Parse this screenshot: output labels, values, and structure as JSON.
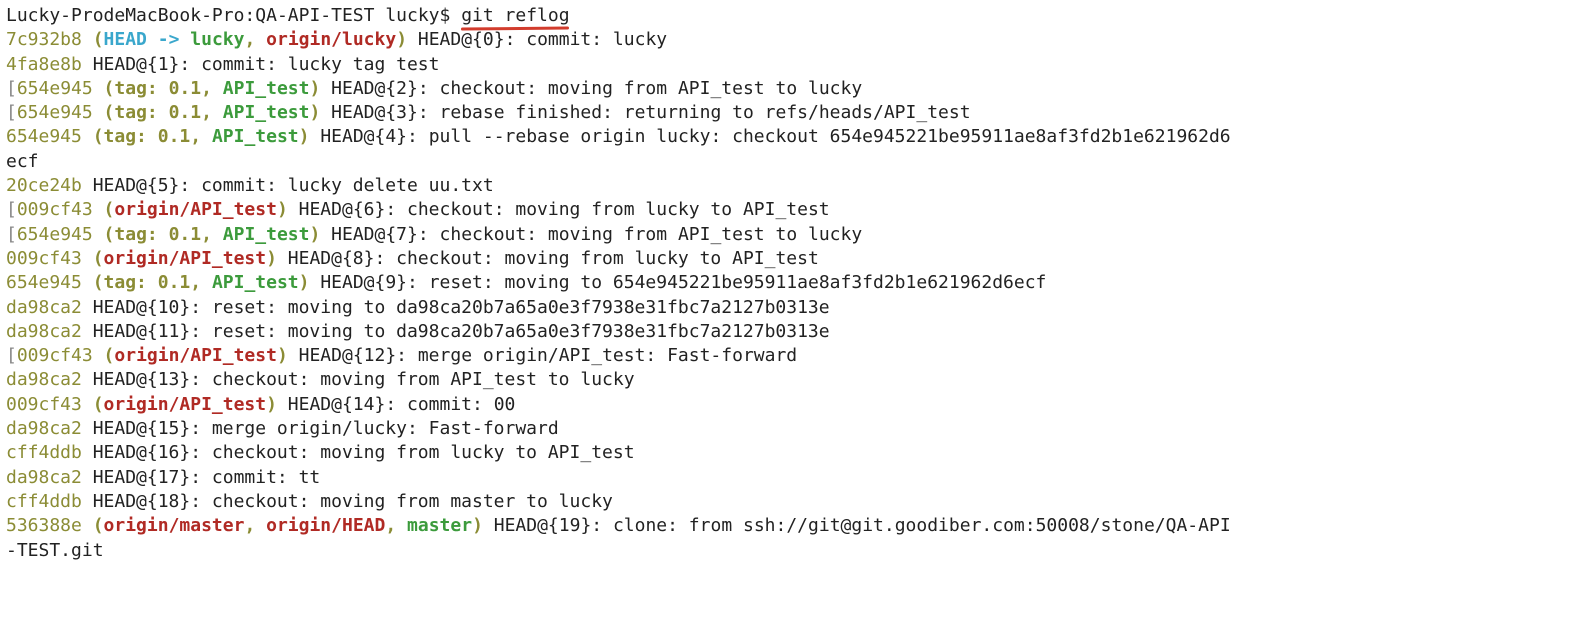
{
  "prompt": {
    "host": "Lucky-ProdeMacBook-Pro",
    "sep": ":",
    "dir": "QA-API-TEST",
    "user": "lucky",
    "dollar": "$",
    "command": "git reflog"
  },
  "wrap_continuation_1": "ecf",
  "wrap_continuation_2": "-TEST.git",
  "entries": [
    {
      "index": 0,
      "lb": "",
      "hash": "7c932b8",
      "refs": [
        {
          "kind": "head",
          "text": "HEAD"
        },
        {
          "kind": "arrow",
          "text": " -> "
        },
        {
          "kind": "branch",
          "text": "lucky"
        },
        {
          "kind": "plain",
          "text": ", "
        },
        {
          "kind": "remote",
          "text": "origin/lucky"
        }
      ],
      "msg": " HEAD@{0}: commit: lucky"
    },
    {
      "index": 1,
      "lb": "",
      "hash": "4fa8e8b",
      "refs": null,
      "msg": " HEAD@{1}: commit: lucky tag test"
    },
    {
      "index": 2,
      "lb": "[",
      "hash": "654e945",
      "refs": [
        {
          "kind": "tag",
          "text": "tag: 0.1"
        },
        {
          "kind": "plain",
          "text": ", "
        },
        {
          "kind": "branch",
          "text": "API_test"
        }
      ],
      "msg": " HEAD@{2}: checkout: moving from API_test to lucky"
    },
    {
      "index": 3,
      "lb": "[",
      "hash": "654e945",
      "refs": [
        {
          "kind": "tag",
          "text": "tag: 0.1"
        },
        {
          "kind": "plain",
          "text": ", "
        },
        {
          "kind": "branch",
          "text": "API_test"
        }
      ],
      "msg": " HEAD@{3}: rebase finished: returning to refs/heads/API_test"
    },
    {
      "index": 4,
      "lb": "",
      "hash": "654e945",
      "refs": [
        {
          "kind": "tag",
          "text": "tag: 0.1"
        },
        {
          "kind": "plain",
          "text": ", "
        },
        {
          "kind": "branch",
          "text": "API_test"
        }
      ],
      "msg": " HEAD@{4}: pull --rebase origin lucky: checkout 654e945221be95911ae8af3fd2b1e621962d6"
    },
    {
      "index": 5,
      "lb": "",
      "hash": "20ce24b",
      "refs": null,
      "msg": " HEAD@{5}: commit: lucky delete uu.txt"
    },
    {
      "index": 6,
      "lb": "[",
      "hash": "009cf43",
      "refs": [
        {
          "kind": "remote",
          "text": "origin/API_test"
        }
      ],
      "msg": " HEAD@{6}: checkout: moving from lucky to API_test"
    },
    {
      "index": 7,
      "lb": "[",
      "hash": "654e945",
      "refs": [
        {
          "kind": "tag",
          "text": "tag: 0.1"
        },
        {
          "kind": "plain",
          "text": ", "
        },
        {
          "kind": "branch",
          "text": "API_test"
        }
      ],
      "msg": " HEAD@{7}: checkout: moving from API_test to lucky"
    },
    {
      "index": 8,
      "lb": "",
      "hash": "009cf43",
      "refs": [
        {
          "kind": "remote",
          "text": "origin/API_test"
        }
      ],
      "msg": " HEAD@{8}: checkout: moving from lucky to API_test"
    },
    {
      "index": 9,
      "lb": "",
      "hash": "654e945",
      "refs": [
        {
          "kind": "tag",
          "text": "tag: 0.1"
        },
        {
          "kind": "plain",
          "text": ", "
        },
        {
          "kind": "branch",
          "text": "API_test"
        }
      ],
      "msg": " HEAD@{9}: reset: moving to 654e945221be95911ae8af3fd2b1e621962d6ecf"
    },
    {
      "index": 10,
      "lb": "",
      "hash": "da98ca2",
      "refs": null,
      "msg": " HEAD@{10}: reset: moving to da98ca20b7a65a0e3f7938e31fbc7a2127b0313e"
    },
    {
      "index": 11,
      "lb": "",
      "hash": "da98ca2",
      "refs": null,
      "msg": " HEAD@{11}: reset: moving to da98ca20b7a65a0e3f7938e31fbc7a2127b0313e"
    },
    {
      "index": 12,
      "lb": "[",
      "hash": "009cf43",
      "refs": [
        {
          "kind": "remote",
          "text": "origin/API_test"
        }
      ],
      "msg": " HEAD@{12}: merge origin/API_test: Fast-forward"
    },
    {
      "index": 13,
      "lb": "",
      "hash": "da98ca2",
      "refs": null,
      "msg": " HEAD@{13}: checkout: moving from API_test to lucky"
    },
    {
      "index": 14,
      "lb": "",
      "hash": "009cf43",
      "refs": [
        {
          "kind": "remote",
          "text": "origin/API_test"
        }
      ],
      "msg": " HEAD@{14}: commit: 00"
    },
    {
      "index": 15,
      "lb": "",
      "hash": "da98ca2",
      "refs": null,
      "msg": " HEAD@{15}: merge origin/lucky: Fast-forward"
    },
    {
      "index": 16,
      "lb": "",
      "hash": "cff4ddb",
      "refs": null,
      "msg": " HEAD@{16}: checkout: moving from lucky to API_test"
    },
    {
      "index": 17,
      "lb": "",
      "hash": "da98ca2",
      "refs": null,
      "msg": " HEAD@{17}: commit: tt"
    },
    {
      "index": 18,
      "lb": "",
      "hash": "cff4ddb",
      "refs": null,
      "msg": " HEAD@{18}: checkout: moving from master to lucky"
    },
    {
      "index": 19,
      "lb": "",
      "hash": "536388e",
      "refs": [
        {
          "kind": "remote",
          "text": "origin/master"
        },
        {
          "kind": "plain",
          "text": ", "
        },
        {
          "kind": "remote",
          "text": "origin/HEAD"
        },
        {
          "kind": "plain",
          "text": ", "
        },
        {
          "kind": "branch",
          "text": "master"
        }
      ],
      "msg": " HEAD@{19}: clone: from ssh://git@git.goodiber.com:50008/stone/QA-API"
    }
  ]
}
